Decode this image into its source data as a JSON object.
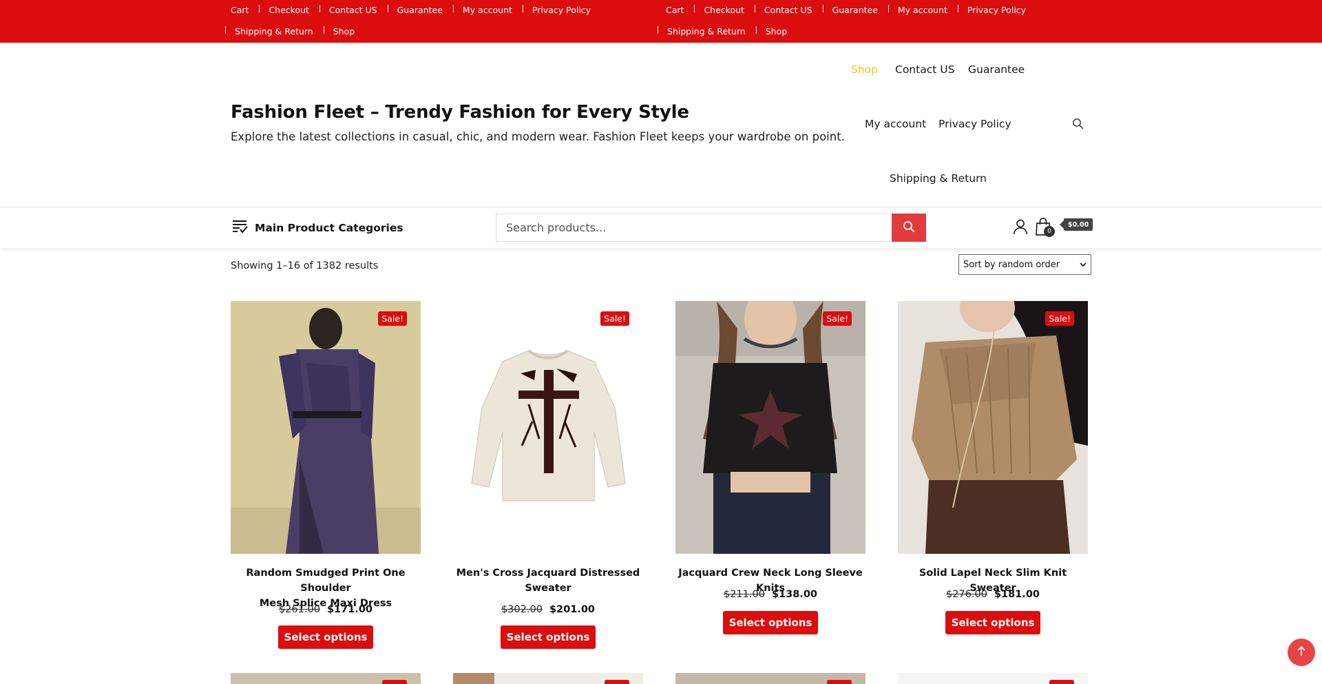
{
  "topbar": {
    "menu_left": {
      "row1": [
        "Cart",
        "Checkout",
        "Contact US",
        "Guarantee",
        "My account",
        "Privacy Policy"
      ],
      "row2": [
        "Shipping & Return",
        "Shop"
      ]
    },
    "menu_right": {
      "row1": [
        "Cart",
        "Checkout",
        "Contact US",
        "Guarantee",
        "My account",
        "Privacy Policy"
      ],
      "row2": [
        "Shipping & Return",
        "Shop"
      ]
    }
  },
  "header": {
    "site_title": "Fashion Fleet – Trendy Fashion for Every Style",
    "site_description": "Explore the latest collections in casual, chic, and modern wear. Fashion Fleet keeps your wardrobe on point.",
    "nav": {
      "shop": "Shop",
      "contact": "Contact US",
      "guarantee": "Guarantee",
      "my_account": "My account",
      "privacy": "Privacy Policy",
      "shipping": "Shipping & Return"
    },
    "active_nav": "Shop"
  },
  "catbar": {
    "categories_label": "Main Product Categories",
    "search_placeholder": "Search products...",
    "cart_count": "0",
    "cart_total": "$0.00"
  },
  "shop": {
    "result_count": "Showing 1–16 of 1382 results",
    "orderby_selected": "Sort by random order"
  },
  "products": [
    {
      "title_line1": "Random Smudged Print One Shoulder",
      "title_line2": "Mesh Splice Maxi Dress",
      "old_price": "$261.00",
      "price": "$171.00",
      "badge": "Sale!",
      "button": "Select options"
    },
    {
      "title_line1": "Men's Cross Jacquard Distressed",
      "title_line2": "Sweater",
      "old_price": "$302.00",
      "price": "$201.00",
      "badge": "Sale!",
      "button": "Select options"
    },
    {
      "title_line1": "Jacquard Crew Neck Long Sleeve Knits",
      "title_line2": "",
      "old_price": "$211.00",
      "price": "$138.00",
      "badge": "Sale!",
      "button": "Select options"
    },
    {
      "title_line1": "Solid Lapel Neck Slim Knit Sweater",
      "title_line2": "",
      "old_price": "$276.00",
      "price": "$181.00",
      "badge": "Sale!",
      "button": "Select options"
    }
  ],
  "colors": {
    "brand_red": "#dc0d0d",
    "active_nav": "#f3c614",
    "search_button": "#e23b3b"
  }
}
